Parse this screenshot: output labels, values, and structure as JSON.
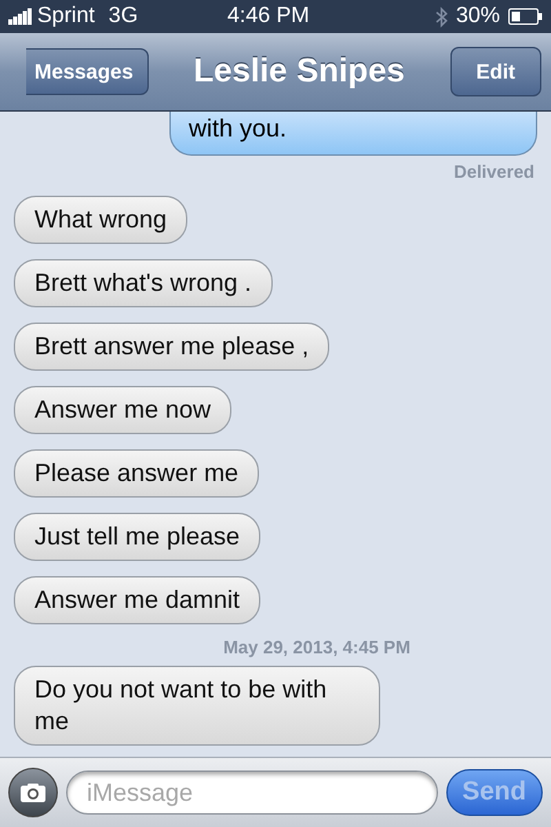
{
  "status_bar": {
    "carrier": "Sprint",
    "network": "3G",
    "time": "4:46 PM",
    "battery": "30%"
  },
  "nav_bar": {
    "back": "Messages",
    "title": "Leslie Snipes",
    "edit": "Edit"
  },
  "messages": [
    {
      "kind": "outgoing",
      "text": "with you."
    },
    {
      "kind": "status",
      "text": "Delivered"
    },
    {
      "kind": "incoming",
      "text": "What wrong"
    },
    {
      "kind": "incoming",
      "text": "Brett what's wrong ."
    },
    {
      "kind": "incoming",
      "text": "Brett answer me please ,"
    },
    {
      "kind": "incoming",
      "text": "Answer me now"
    },
    {
      "kind": "incoming",
      "text": "Please answer me"
    },
    {
      "kind": "incoming",
      "text": "Just tell me please"
    },
    {
      "kind": "incoming",
      "text": "Answer me damnit"
    },
    {
      "kind": "timestamp",
      "text": "May 29, 2013, 4:45 PM"
    },
    {
      "kind": "incoming",
      "text": "Do you not want to be with me"
    }
  ],
  "compose": {
    "placeholder": "iMessage",
    "send": "Send",
    "send_disabled": true
  }
}
